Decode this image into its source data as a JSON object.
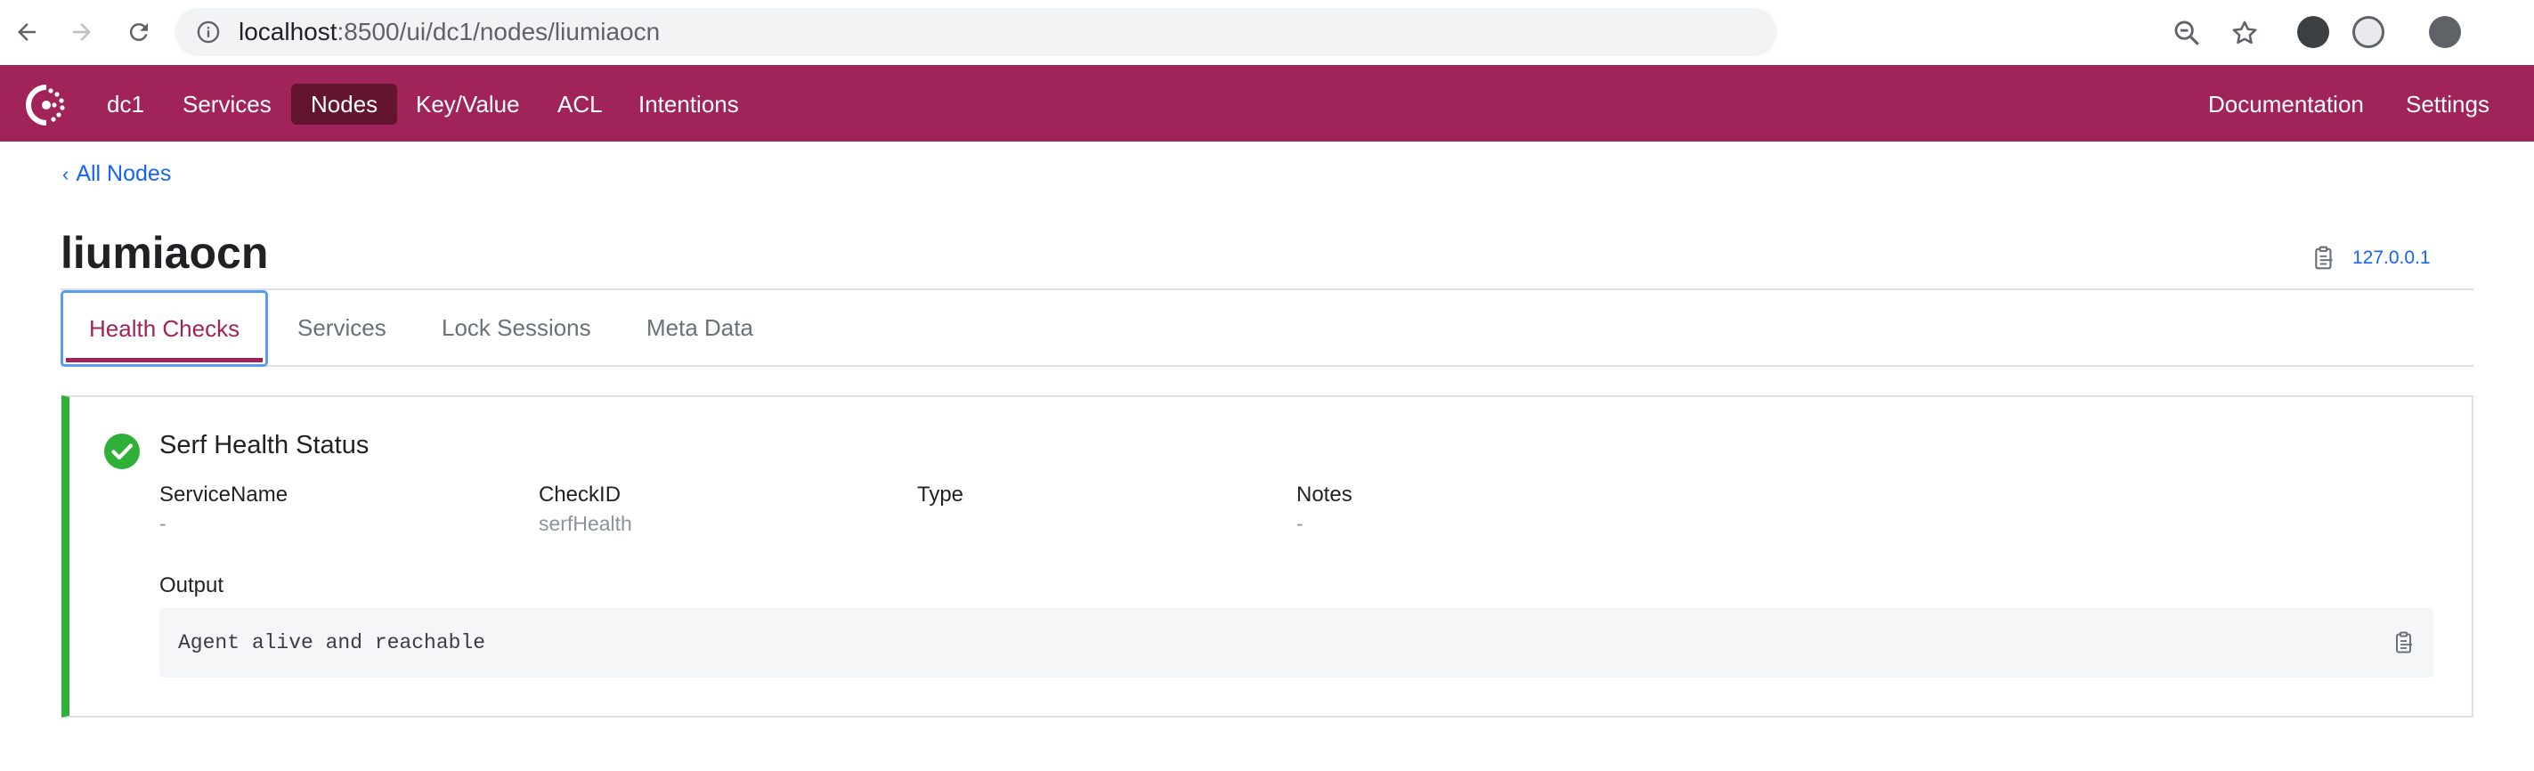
{
  "browser": {
    "url_host": "localhost",
    "url_rest": ":8500/ui/dc1/nodes/liumiaocn"
  },
  "header": {
    "datacenter": "dc1",
    "nav": [
      {
        "label": "Services"
      },
      {
        "label": "Nodes",
        "active": true
      },
      {
        "label": "Key/Value"
      },
      {
        "label": "ACL"
      },
      {
        "label": "Intentions"
      }
    ],
    "right": [
      {
        "label": "Documentation"
      },
      {
        "label": "Settings"
      }
    ]
  },
  "breadcrumb": {
    "chevron": "‹",
    "label": "All Nodes"
  },
  "node": {
    "name": "liumiaocn",
    "address": "127.0.0.1"
  },
  "tabs": [
    {
      "label": "Health Checks",
      "active": true
    },
    {
      "label": "Services"
    },
    {
      "label": "Lock Sessions"
    },
    {
      "label": "Meta Data"
    }
  ],
  "health_check": {
    "status": "passing",
    "status_icon": "check-circle-icon",
    "title": "Serf Health Status",
    "fields": [
      {
        "label": "ServiceName",
        "value": "-"
      },
      {
        "label": "CheckID",
        "value": "serfHealth"
      },
      {
        "label": "Type",
        "value": ""
      },
      {
        "label": "Notes",
        "value": "-"
      }
    ],
    "output_label": "Output",
    "output": "Agent alive and reachable"
  },
  "colors": {
    "brand": "#a02459",
    "brand_dark": "#63142f",
    "link": "#1563ff",
    "passing": "#2eb039",
    "focus_ring": "#5b9cf3"
  }
}
